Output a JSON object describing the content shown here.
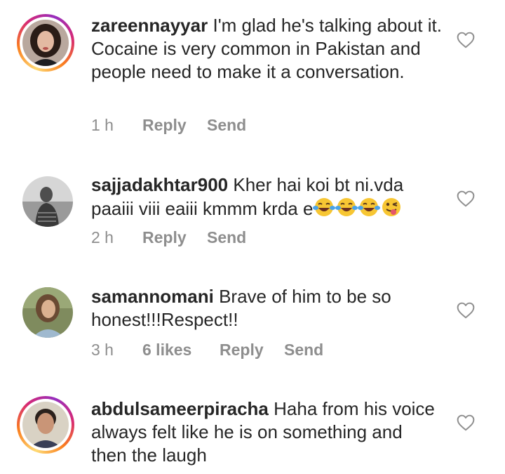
{
  "comments": [
    {
      "username": "zareennayyar",
      "text": "I'm glad he's talking about it. Cocaine is very common in Pakistan and people need to make it a conversation.",
      "time": "1 h",
      "likes": "",
      "reply_label": "Reply",
      "send_label": "Send",
      "avatar_story_ring": true
    },
    {
      "username": "sajjadakhtar900",
      "text": "Kher hai koi bt ni.vda paaiii viii eaiii kmmm krda e",
      "emojis": [
        "face-with-tears-of-joy",
        "face-with-tears-of-joy",
        "face-with-tears-of-joy",
        "winking-face-with-tongue"
      ],
      "time": "2 h",
      "likes": "",
      "reply_label": "Reply",
      "send_label": "Send",
      "avatar_story_ring": false
    },
    {
      "username": "samannomani",
      "text": "Brave of him to be so honest!!!Respect!!",
      "time": "3 h",
      "likes": "6 likes",
      "reply_label": "Reply",
      "send_label": "Send",
      "avatar_story_ring": false
    },
    {
      "username": "abdulsameerpiracha",
      "text": "Haha from his voice always felt like he is on something and then the laugh",
      "time": "",
      "likes": "",
      "reply_label": "",
      "send_label": "",
      "avatar_story_ring": true
    }
  ],
  "icons": {
    "like": "heart-outline-icon"
  },
  "colors": {
    "text": "#262626",
    "meta": "#8e8e8e",
    "heart": "#8e8e8e"
  }
}
